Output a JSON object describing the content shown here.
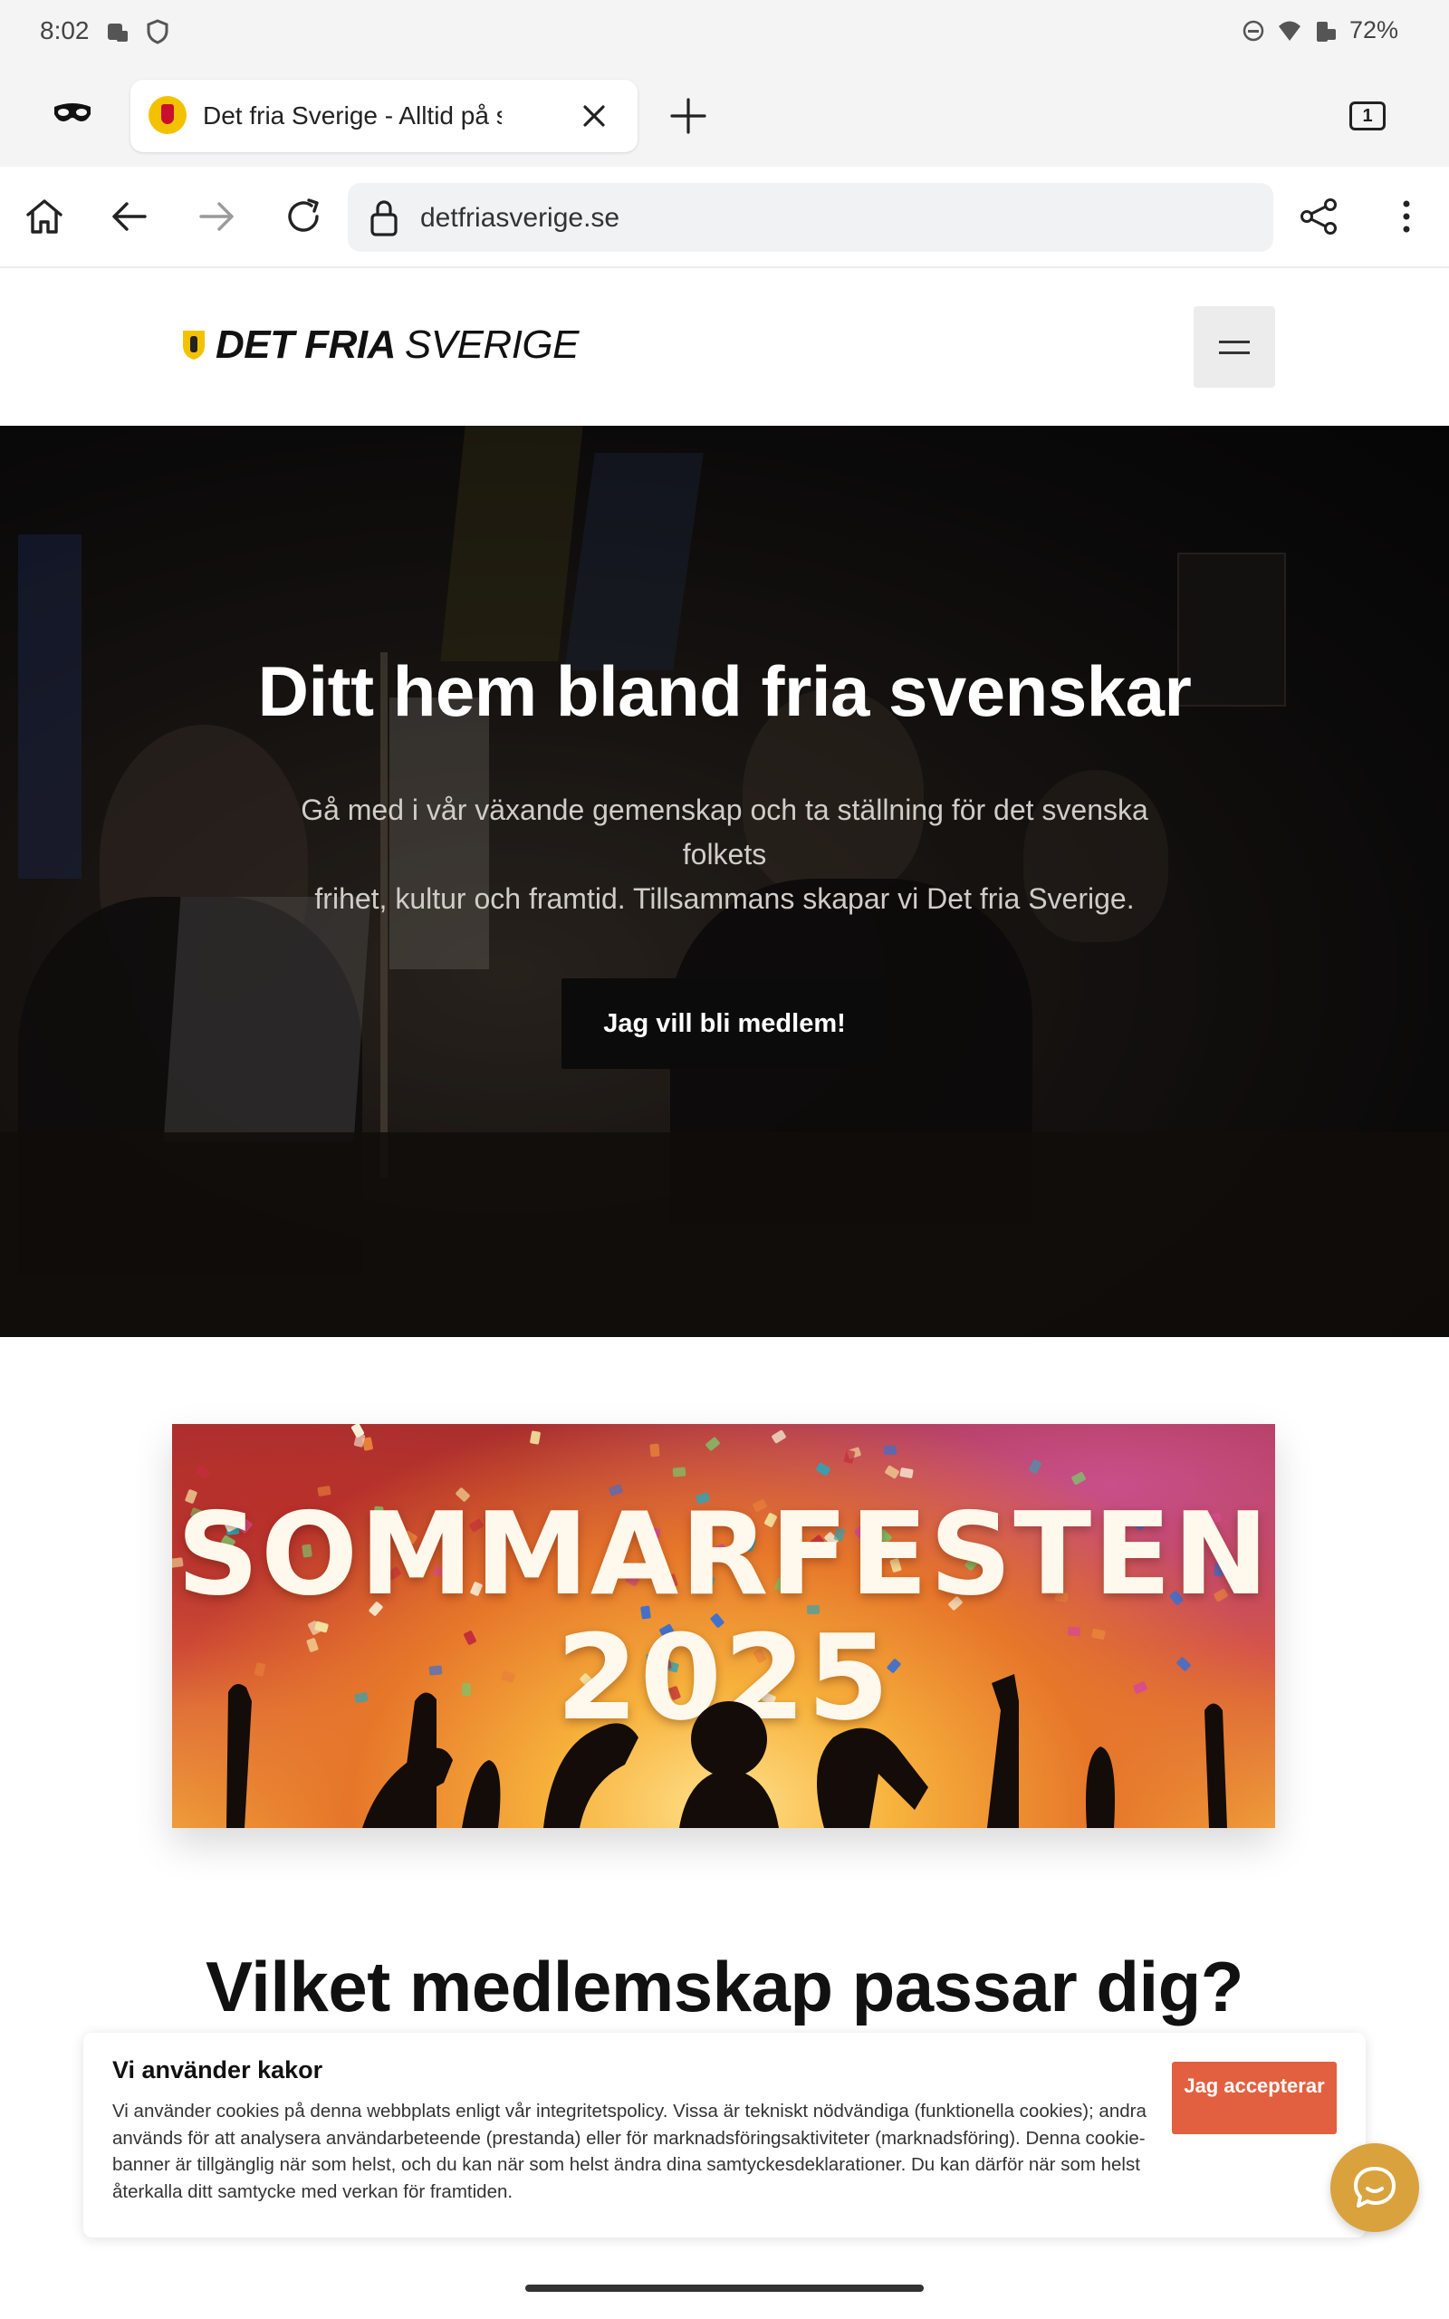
{
  "status_bar": {
    "time": "8:02",
    "battery": "72%"
  },
  "browser": {
    "tab_title": "Det fria Sverige - Alltid på svenskarnas sida",
    "tab_count": "1",
    "url": "detfriasverige.se"
  },
  "site": {
    "logo_bold": "DET FRIA",
    "logo_light": "SVERIGE"
  },
  "hero": {
    "title": "Ditt hem bland fria svenskar",
    "subtitle_line1": "Gå med i vår växande gemenskap och ta ställning för det svenska folkets",
    "subtitle_line2": "frihet,  kultur och framtid. Tillsammans skapar vi Det fria Sverige.",
    "cta_label": "Jag vill bli medlem!"
  },
  "banner": {
    "title_line1": "SOMMARFESTEN",
    "title_line2": "2025"
  },
  "section": {
    "heading": "Vilket medlemskap passar dig?"
  },
  "cookie": {
    "title": "Vi använder kakor",
    "text": "Vi använder cookies på denna webbplats enligt vår integritetspolicy. Vissa är tekniskt nödvändiga (funktionella cookies); andra används för att analysera användarbeteende (prestanda) eller för marknadsföringsaktiviteter (marknadsföring). Denna cookie-banner är tillgänglig när som helst, och du kan när som helst ändra dina samtyckesdeklarationer. Du kan därför när som helst återkalla ditt samtycke med verkan för framtiden.",
    "accept_label": "Jag accepterar"
  },
  "colors": {
    "accept_button": "#e2603f",
    "chat_button": "#d9a23d",
    "cta_button": "#0b0b0b"
  }
}
